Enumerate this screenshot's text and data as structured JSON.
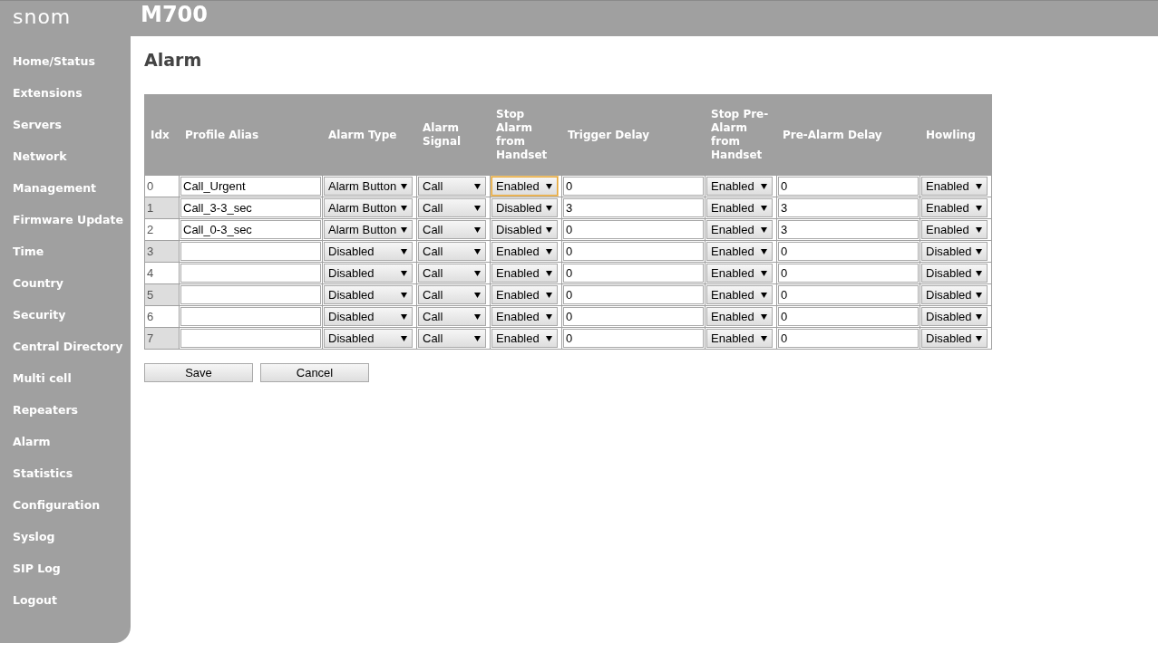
{
  "header": {
    "logo": "snom",
    "title": "M700"
  },
  "sidebar": {
    "items": [
      "Home/Status",
      "Extensions",
      "Servers",
      "Network",
      "Management",
      "Firmware Update",
      "Time",
      "Country",
      "Security",
      "Central Directory",
      "Multi cell",
      "Repeaters",
      "Alarm",
      "Statistics",
      "Configuration",
      "Syslog",
      "SIP Log",
      "Logout"
    ]
  },
  "page_title": "Alarm",
  "table": {
    "columns": [
      "Idx",
      "Profile Alias",
      "Alarm Type",
      "Alarm Signal",
      "Stop Alarm from Handset",
      "Trigger Delay",
      "Stop Pre-Alarm from Handset",
      "Pre-Alarm Delay",
      "Howling"
    ],
    "rows": [
      {
        "idx": "0",
        "alias": "Call_Urgent",
        "alarm_type": "Alarm Button",
        "alarm_signal": "Call",
        "stop_alarm": "Enabled",
        "stop_alarm_focused": true,
        "trigger_delay": "0",
        "stop_pre_alarm": "Enabled",
        "pre_alarm_delay": "0",
        "howling": "Enabled"
      },
      {
        "idx": "1",
        "alias": "Call_3-3_sec",
        "alarm_type": "Alarm Button",
        "alarm_signal": "Call",
        "stop_alarm": "Disabled",
        "stop_alarm_focused": false,
        "trigger_delay": "3",
        "stop_pre_alarm": "Enabled",
        "pre_alarm_delay": "3",
        "howling": "Enabled"
      },
      {
        "idx": "2",
        "alias": "Call_0-3_sec",
        "alarm_type": "Alarm Button",
        "alarm_signal": "Call",
        "stop_alarm": "Disabled",
        "stop_alarm_focused": false,
        "trigger_delay": "0",
        "stop_pre_alarm": "Enabled",
        "pre_alarm_delay": "3",
        "howling": "Enabled"
      },
      {
        "idx": "3",
        "alarm_type": "Disabled",
        "alarm_signal": "Call",
        "stop_alarm": "Enabled",
        "stop_alarm_focused": false,
        "trigger_delay": "0",
        "stop_pre_alarm": "Enabled",
        "pre_alarm_delay": "0",
        "howling": "Disabled"
      },
      {
        "idx": "4",
        "alarm_type": "Disabled",
        "alarm_signal": "Call",
        "stop_alarm": "Enabled",
        "stop_alarm_focused": false,
        "trigger_delay": "0",
        "stop_pre_alarm": "Enabled",
        "pre_alarm_delay": "0",
        "howling": "Disabled"
      },
      {
        "idx": "5",
        "alarm_type": "Disabled",
        "alarm_signal": "Call",
        "stop_alarm": "Enabled",
        "stop_alarm_focused": false,
        "trigger_delay": "0",
        "stop_pre_alarm": "Enabled",
        "pre_alarm_delay": "0",
        "howling": "Disabled"
      },
      {
        "idx": "6",
        "alarm_type": "Disabled",
        "alarm_signal": "Call",
        "stop_alarm": "Enabled",
        "stop_alarm_focused": false,
        "trigger_delay": "0",
        "stop_pre_alarm": "Enabled",
        "pre_alarm_delay": "0",
        "howling": "Disabled"
      },
      {
        "idx": "7",
        "alarm_type": "Disabled",
        "alarm_signal": "Call",
        "stop_alarm": "Enabled",
        "stop_alarm_focused": false,
        "trigger_delay": "0",
        "stop_pre_alarm": "Enabled",
        "pre_alarm_delay": "0",
        "howling": "Disabled"
      }
    ]
  },
  "buttons": [
    "Save",
    "Cancel"
  ]
}
